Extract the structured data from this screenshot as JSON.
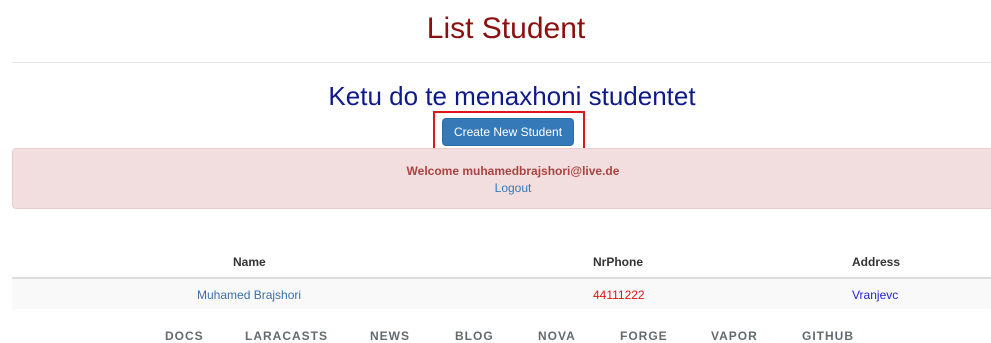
{
  "page": {
    "title": "List Student",
    "subtitle": "Ketu do te menaxhoni studentet",
    "create_button_label": "Create New Student"
  },
  "alert": {
    "welcome_text": "Welcome muhamedbrajshori@live.de",
    "logout_label": "Logout"
  },
  "table": {
    "headers": [
      "Name",
      "NrPhone",
      "Address"
    ],
    "rows": [
      [
        "Muhamed Brajshori",
        "44111222",
        "Vranjevc"
      ]
    ]
  },
  "footer": {
    "links": [
      "DOCS",
      "LARACASTS",
      "NEWS",
      "BLOG",
      "NOVA",
      "FORGE",
      "VAPOR",
      "GITHUB"
    ]
  },
  "colors": {
    "title": "#8b0f0f",
    "subtitle": "#0f1a8a",
    "button": "#3579b9",
    "highlight_frame": "#e0161b",
    "alert_bg": "#f2dede",
    "alert_text": "#a94442"
  }
}
